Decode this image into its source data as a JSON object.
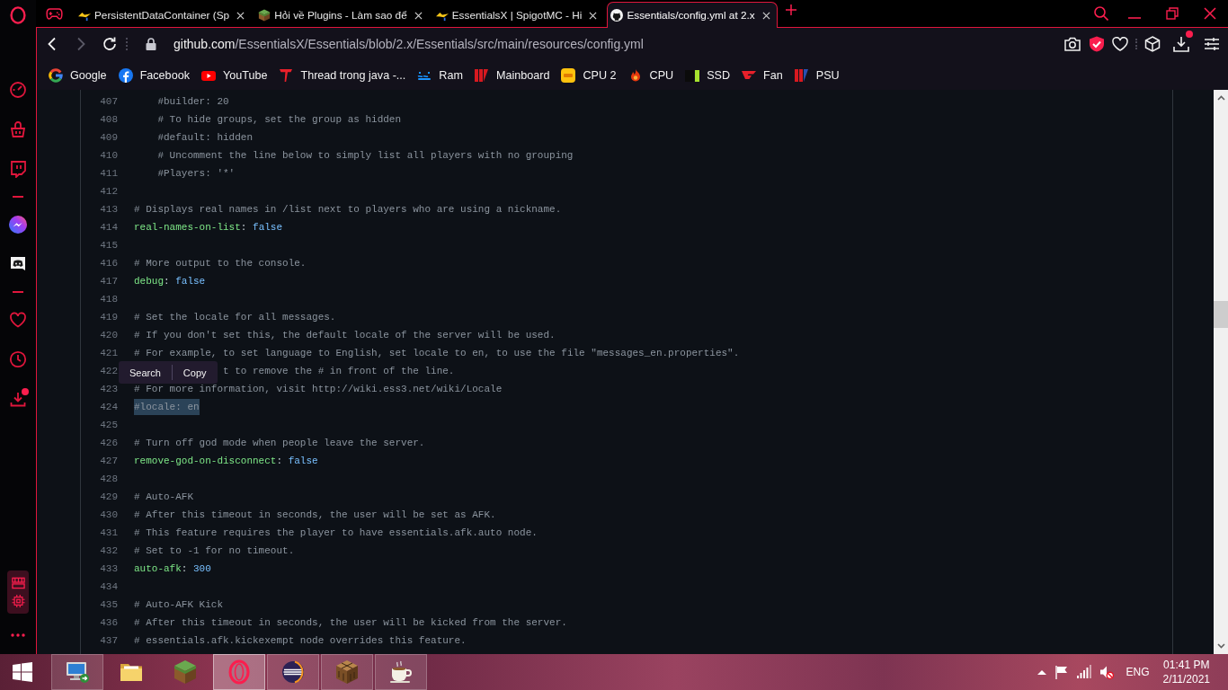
{
  "tab_strip": {
    "tabs": [
      {
        "title": "PersistentDataContainer (Sp",
        "selected": false
      },
      {
        "title": "Hỏi về Plugins - Làm sao để",
        "selected": false
      },
      {
        "title": "EssentialsX | SpigotMC - Hi",
        "selected": false
      },
      {
        "title": "Essentials/config.yml at 2.x",
        "selected": true
      }
    ]
  },
  "toolbar": {
    "navigation": [
      {
        "kind": "back",
        "disabled": false
      },
      {
        "kind": "forward",
        "disabled": true
      },
      {
        "kind": "reload",
        "disabled": false
      }
    ],
    "address": {
      "domain": "github.com",
      "path": "/EssentialsX/Essentials/blob/2.x/Essentials/src/main/resources/config.yml"
    },
    "downloads_notification": true
  },
  "bookmarks": [
    "Google",
    "Facebook",
    "YouTube",
    "Thread trong java -...",
    "Ram",
    "Mainboard",
    "CPU 2",
    "CPU",
    "SSD",
    "Fan",
    "PSU"
  ],
  "sidebar": {
    "downloads_notification": true
  },
  "code": {
    "lines": [
      {
        "number": "407",
        "indented": true,
        "selected": false,
        "segments": [
          {
            "kind": "comment",
            "text": "#builder: 20"
          }
        ]
      },
      {
        "number": "408",
        "indented": true,
        "selected": false,
        "segments": [
          {
            "kind": "comment",
            "text": "# To hide groups, set the group as hidden"
          }
        ]
      },
      {
        "number": "409",
        "indented": true,
        "selected": false,
        "segments": [
          {
            "kind": "comment",
            "text": "#default: hidden"
          }
        ]
      },
      {
        "number": "410",
        "indented": true,
        "selected": false,
        "segments": [
          {
            "kind": "comment",
            "text": "# Uncomment the line below to simply list all players with no grouping"
          }
        ]
      },
      {
        "number": "411",
        "indented": true,
        "selected": false,
        "segments": [
          {
            "kind": "comment",
            "text": "#Players: '*'"
          }
        ]
      },
      {
        "number": "412",
        "selected": false
      },
      {
        "number": "413",
        "selected": false,
        "segments": [
          {
            "kind": "comment",
            "text": "# Displays real names in /list next to players who are using a nickname."
          }
        ]
      },
      {
        "number": "414",
        "selected": false,
        "segments": [
          {
            "kind": "key",
            "text": "real-names-on-list"
          },
          {
            "kind": "punct",
            "text": ": "
          },
          {
            "kind": "value",
            "text": "false"
          }
        ]
      },
      {
        "number": "415",
        "selected": false
      },
      {
        "number": "416",
        "selected": false,
        "segments": [
          {
            "kind": "comment",
            "text": "# More output to the console."
          }
        ]
      },
      {
        "number": "417",
        "selected": false,
        "segments": [
          {
            "kind": "key",
            "text": "debug"
          },
          {
            "kind": "punct",
            "text": ": "
          },
          {
            "kind": "value",
            "text": "false"
          }
        ]
      },
      {
        "number": "418",
        "selected": false
      },
      {
        "number": "419",
        "selected": false,
        "segments": [
          {
            "kind": "comment",
            "text": "# Set the locale for all messages."
          }
        ]
      },
      {
        "number": "420",
        "selected": false,
        "segments": [
          {
            "kind": "comment",
            "text": "# If you don't set this, the default locale of the server will be used."
          }
        ]
      },
      {
        "number": "421",
        "selected": false,
        "segments": [
          {
            "kind": "comment",
            "text": "# For example, to set language to English, set locale to en, to use the file \"messages_en.properties\"."
          }
        ]
      },
      {
        "number": "422",
        "partly_covered": true,
        "selected": false,
        "segments": [
          {
            "kind": "comment",
            "text": "t to remove the # in front of the line."
          }
        ]
      },
      {
        "number": "423",
        "selected": false,
        "segments": [
          {
            "kind": "comment",
            "text": "# For more information, visit http://wiki.ess3.net/wiki/Locale"
          }
        ]
      },
      {
        "number": "424",
        "selected": true,
        "segments": [
          {
            "kind": "comment",
            "text": "#locale: en"
          }
        ]
      },
      {
        "number": "425",
        "selected": false
      },
      {
        "number": "426",
        "selected": false,
        "segments": [
          {
            "kind": "comment",
            "text": "# Turn off god mode when people leave the server."
          }
        ]
      },
      {
        "number": "427",
        "selected": false,
        "segments": [
          {
            "kind": "key",
            "text": "remove-god-on-disconnect"
          },
          {
            "kind": "punct",
            "text": ": "
          },
          {
            "kind": "value",
            "text": "false"
          }
        ]
      },
      {
        "number": "428",
        "selected": false
      },
      {
        "number": "429",
        "selected": false,
        "segments": [
          {
            "kind": "comment",
            "text": "# Auto-AFK"
          }
        ]
      },
      {
        "number": "430",
        "selected": false,
        "segments": [
          {
            "kind": "comment",
            "text": "# After this timeout in seconds, the user will be set as AFK."
          }
        ]
      },
      {
        "number": "431",
        "selected": false,
        "segments": [
          {
            "kind": "comment",
            "text": "# This feature requires the player to have essentials.afk.auto node."
          }
        ]
      },
      {
        "number": "432",
        "selected": false,
        "segments": [
          {
            "kind": "comment",
            "text": "# Set to -1 for no timeout."
          }
        ]
      },
      {
        "number": "433",
        "selected": false,
        "segments": [
          {
            "kind": "key",
            "text": "auto-afk"
          },
          {
            "kind": "punct",
            "text": ": "
          },
          {
            "kind": "value",
            "text": "300"
          }
        ]
      },
      {
        "number": "434",
        "selected": false
      },
      {
        "number": "435",
        "selected": false,
        "segments": [
          {
            "kind": "comment",
            "text": "# Auto-AFK Kick"
          }
        ]
      },
      {
        "number": "436",
        "selected": false,
        "segments": [
          {
            "kind": "comment",
            "text": "# After this timeout in seconds, the user will be kicked from the server."
          }
        ]
      },
      {
        "number": "437",
        "selected": false,
        "segments": [
          {
            "kind": "comment",
            "text": "# essentials.afk.kickexempt node overrides this feature."
          }
        ]
      }
    ]
  },
  "context_popup": {
    "actions": [
      "Search",
      "Copy"
    ]
  },
  "taskbar": {
    "apps": [
      {
        "running": true,
        "selected": false
      },
      {
        "running": false,
        "selected": false
      },
      {
        "running": false,
        "selected": false
      },
      {
        "running": true,
        "selected": true
      },
      {
        "running": true,
        "selected": false
      },
      {
        "running": true,
        "selected": false
      },
      {
        "running": true,
        "selected": false
      }
    ],
    "volume_muted": true,
    "language": "ENG",
    "time": "01:41 PM",
    "date": "2/11/2021"
  }
}
